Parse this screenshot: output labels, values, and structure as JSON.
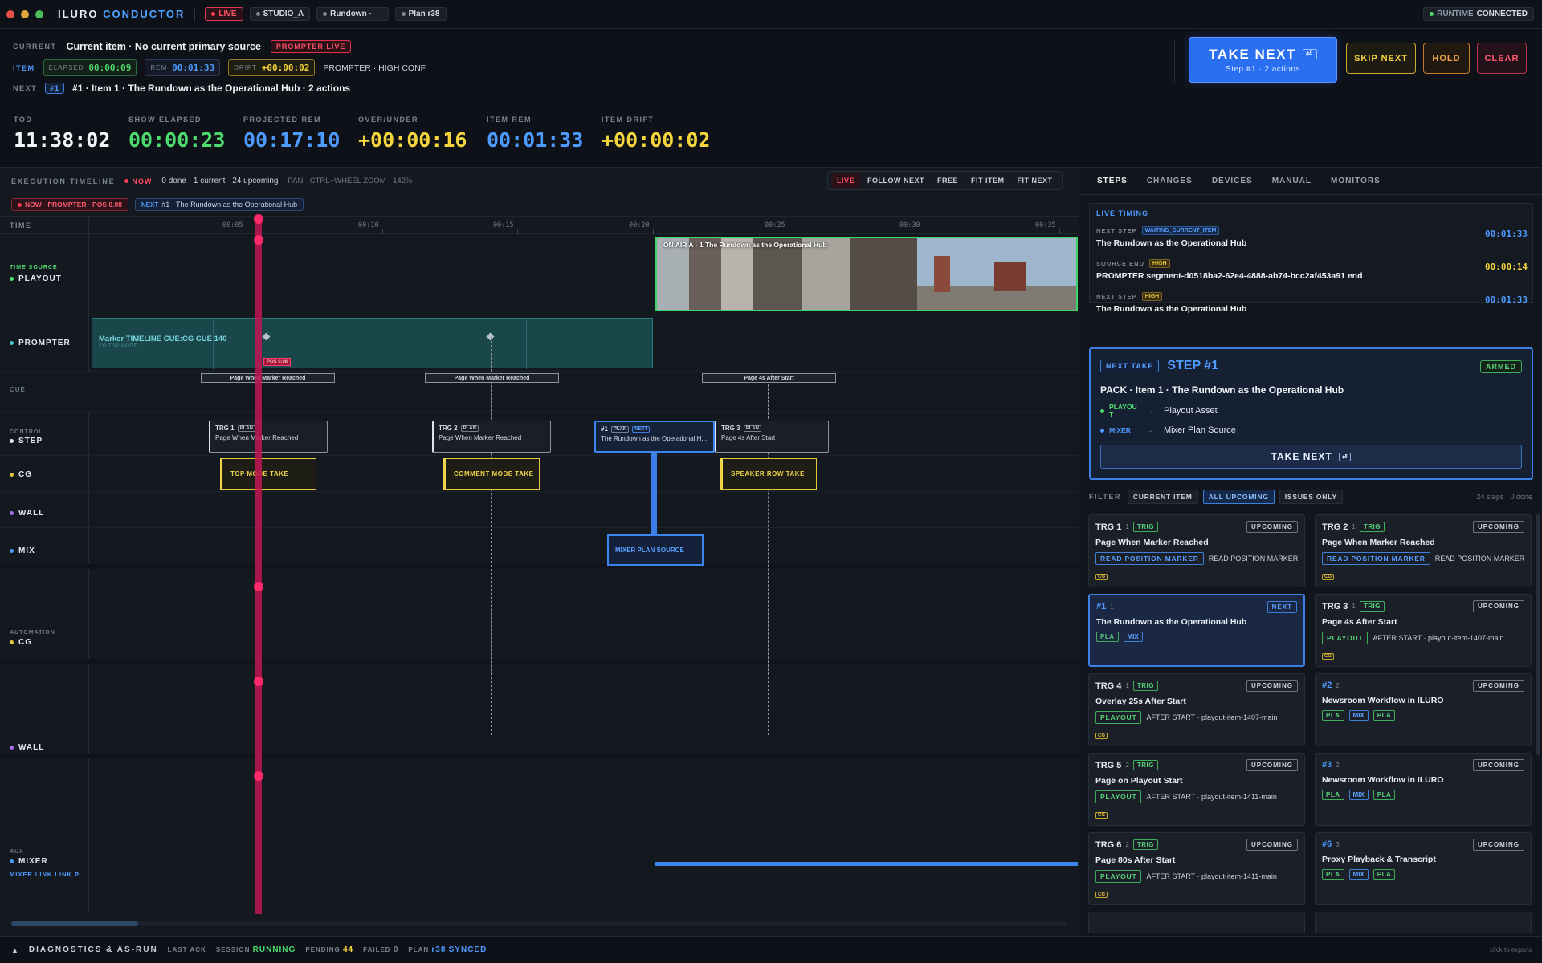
{
  "app": {
    "brand_a": "ILURO",
    "brand_b": "CONDUCTOR"
  },
  "titlebar": {
    "live": "LIVE",
    "studio": "STUDIO_A",
    "rundown": "Rundown · —",
    "plan": "Plan r38",
    "runtime_label": "RUNTIME",
    "runtime_value": "CONNECTED"
  },
  "current": {
    "label": "CURRENT",
    "text": "Current item · No current primary source",
    "prompter_badge": "PROMPTER LIVE",
    "item_label": "ITEM",
    "elapsed_label": "ELAPSED",
    "elapsed": "00:00:09",
    "rem_label": "REM",
    "rem": "00:01:33",
    "drift_label": "DRIFT",
    "drift": "+00:00:02",
    "source": "PROMPTER · HIGH CONF",
    "next_label": "NEXT",
    "next_num": "#1",
    "next_text": "#1 · Item 1 · The Rundown as the Operational Hub · 2 actions"
  },
  "actions": {
    "take_next": "TAKE NEXT",
    "take_key": "⏎",
    "take_sub": "Step #1 · 2 actions",
    "skip": "SKIP NEXT",
    "hold": "HOLD",
    "clear": "CLEAR"
  },
  "clocks": [
    {
      "label": "TOD",
      "value": "11:38:02",
      "color": "#f2f5f9"
    },
    {
      "label": "SHOW ELAPSED",
      "value": "00:00:23",
      "color": "#4ddb6e"
    },
    {
      "label": "PROJECTED REM",
      "value": "00:17:10",
      "color": "#4d9bff"
    },
    {
      "label": "OVER/UNDER",
      "value": "+00:00:16",
      "color": "#f5d53d"
    },
    {
      "label": "ITEM REM",
      "value": "00:01:33",
      "color": "#4d9bff"
    },
    {
      "label": "ITEM DRIFT",
      "value": "+00:00:02",
      "color": "#f5d53d"
    }
  ],
  "timeline": {
    "title": "EXECUTION TIMELINE",
    "now": "NOW",
    "summary": "0 done · 1 current · 24 upcoming",
    "hint": "PAN · CTRL+WHEEL ZOOM · 142%",
    "modes": [
      "LIVE",
      "FOLLOW NEXT",
      "FREE",
      "FIT ITEM",
      "FIT NEXT"
    ],
    "now_chip": "NOW · PROMPTER · POS 0.98",
    "next_chip_label": "NEXT",
    "next_chip": "#1 · The Rundown as the Operational Hub",
    "time_label": "TIME",
    "ticks": [
      "00:05",
      "00:10",
      "00:15",
      "00:20",
      "00:25",
      "00:30",
      "00:35"
    ],
    "lanes": {
      "time_source": "TIME SOURCE",
      "playout": "PLAYOUT",
      "prompter": "PROMPTER",
      "cue": "CUE",
      "control": "CONTROL",
      "step": "STEP",
      "cg": "CG",
      "wall": "WALL",
      "mix": "MIX",
      "automation": "AUTOMATION",
      "cg2": "CG",
      "wall2": "WALL",
      "aux": "AUX",
      "mixer": "MIXER",
      "mixer_sub": "MIXER LINK LINK P..."
    },
    "on_air": "ON AIR A · 1 The Rundown as the Operational Hub",
    "marker_title": "Marker TIMELINE CUE:CG CUE 140",
    "marker_sub": "CG TOP MODE",
    "pos_tag": "POS 0.98",
    "cues": [
      "Page When Marker Reached",
      "Page When Marker Reached",
      "Page 4s After Start"
    ],
    "steps": [
      {
        "id": "TRG 1",
        "tag": "PLAN",
        "text": "Page When Marker Reached"
      },
      {
        "id": "TRG 2",
        "tag": "PLAN",
        "text": "Page When Marker Reached"
      },
      {
        "id": "#1",
        "tag": "PLAN",
        "tag2": "NEXT",
        "text": "The Rundown as the Operational H..."
      },
      {
        "id": "TRG 3",
        "tag": "PLAN",
        "text": "Page 4s After Start"
      }
    ],
    "cg_boxes": [
      "TOP MODE TAKE",
      "COMMENT MODE TAKE",
      "SPEAKER ROW TAKE"
    ],
    "mixer_box": "MIXER PLAN SOURCE"
  },
  "right": {
    "tabs": [
      "STEPS",
      "CHANGES",
      "DEVICES",
      "MANUAL",
      "MONITORS"
    ],
    "live_timing": "LIVE TIMING",
    "timing": [
      {
        "label": "NEXT STEP",
        "badge": "WAITING_CURRENT_ITEM",
        "title": "The Rundown as the Operational Hub",
        "time": "00:01:33",
        "color": "#4d9bff"
      },
      {
        "label": "SOURCE END",
        "badge": "HIGH",
        "title": "PROMPTER segment-d0518ba2-62e4-4888-ab74-bcc2af453a91 end",
        "time": "00:00:14",
        "color": "#f5d53d"
      },
      {
        "label": "NEXT STEP",
        "badge": "HIGH",
        "title": "The Rundown as the Operational Hub",
        "time": "00:01:33",
        "color": "#4d9bff"
      }
    ],
    "next_take": {
      "badge": "NEXT TAKE",
      "step": "STEP #1",
      "armed": "ARMED",
      "pack": "PACK · Item 1 · The Rundown as the Operational Hub",
      "rows": [
        {
          "dev": "PLAYOUT",
          "dev_l1": "PLAYOU",
          "dev_l2": "T",
          "target": "Playout Asset"
        },
        {
          "dev": "MIXER",
          "target": "Mixer Plan Source"
        }
      ],
      "button": "TAKE NEXT",
      "key": "⏎"
    },
    "filter_label": "FILTER",
    "filters": [
      "CURRENT ITEM",
      "ALL UPCOMING",
      "ISSUES ONLY"
    ],
    "count": "24 steps · 0 done",
    "cards": [
      {
        "id": "TRG 1",
        "n": "1",
        "type": "TRIG",
        "state": "UPCOMING",
        "title": "Page When Marker Reached",
        "chip": "READ POSITION MARKER",
        "detail": "READ POSITION MARKER ·"
      },
      {
        "id": "TRG 2",
        "n": "1",
        "type": "TRIG",
        "state": "UPCOMING",
        "title": "Page When Marker Reached",
        "chip": "READ POSITION MARKER",
        "detail": "READ POSITION MARKER ·"
      },
      {
        "id": "#1",
        "n": "1",
        "type": "",
        "state": "NEXT",
        "title": "The Rundown as the Operational Hub",
        "chip": "",
        "detail": ""
      },
      {
        "id": "TRG 3",
        "n": "1",
        "type": "TRIG",
        "state": "UPCOMING",
        "title": "Page 4s After Start",
        "chip": "PLAYOUT",
        "detail": "AFTER START · playout-item-1407-main"
      },
      {
        "id": "TRG 4",
        "n": "1",
        "type": "TRIG",
        "state": "UPCOMING",
        "title": "Overlay 25s After Start",
        "chip": "PLAYOUT",
        "detail": "AFTER START · playout-item-1407-main"
      },
      {
        "id": "#2",
        "n": "2",
        "type": "",
        "state": "UPCOMING",
        "title": "Newsroom Workflow in ILURO",
        "chip": "",
        "detail": ""
      },
      {
        "id": "TRG 5",
        "n": "2",
        "type": "TRIG",
        "state": "UPCOMING",
        "title": "Page on Playout Start",
        "chip": "PLAYOUT",
        "detail": "AFTER START · playout-item-1411-main"
      },
      {
        "id": "#3",
        "n": "2",
        "type": "",
        "state": "UPCOMING",
        "title": "Newsroom Workflow in ILURO",
        "chip": "",
        "detail": ""
      },
      {
        "id": "TRG 6",
        "n": "2",
        "type": "TRIG",
        "state": "UPCOMING",
        "title": "Page 80s After Start",
        "chip": "PLAYOUT",
        "detail": "AFTER START · playout-item-1411-main"
      },
      {
        "id": "#6",
        "n": "3",
        "type": "",
        "state": "UPCOMING",
        "title": "Proxy Playback & Transcript",
        "chip": "",
        "detail": ""
      }
    ],
    "tags": {
      "cg": "CG",
      "pla": "PLA",
      "mix": "MIX"
    }
  },
  "footer": {
    "title": "DIAGNOSTICS & AS-RUN",
    "last_ack": "LAST ACK",
    "session_label": "SESSION",
    "session": "RUNNING",
    "pending_label": "PENDING",
    "pending": "44",
    "failed_label": "FAILED",
    "failed": "0",
    "plan_label": "PLAN",
    "plan": "r38",
    "synced": "SYNCED",
    "expand": "click to expand"
  }
}
